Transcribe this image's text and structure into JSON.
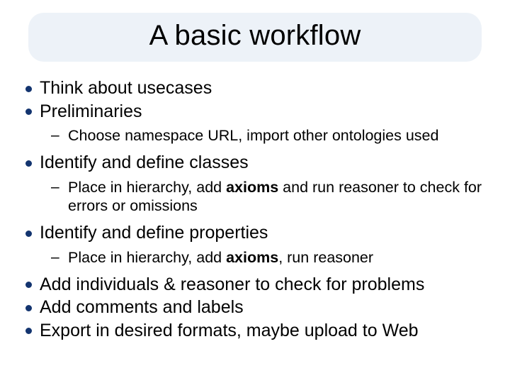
{
  "title": "A basic workflow",
  "bullets": {
    "b0": "Think about usecases",
    "b1": "Preliminaries",
    "b1a": "Choose namespace URL, import other ontologies used",
    "b2": "Identify and define classes",
    "b2a_pre": "Place in hierarchy, add ",
    "b2a_bold": "axioms",
    "b2a_post": " and run reasoner to check for errors or omissions",
    "b3": "Identify and define properties",
    "b3a_pre": "Place in hierarchy, add ",
    "b3a_bold": "axioms",
    "b3a_post": ", run reasoner",
    "b4": "Add individuals & reasoner to check for problems",
    "b5": "Add comments and labels",
    "b6": "Export in desired formats, maybe upload to Web"
  }
}
